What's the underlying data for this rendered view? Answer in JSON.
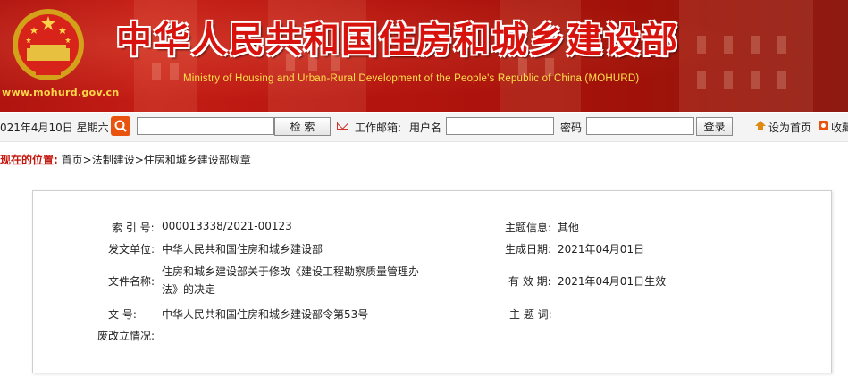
{
  "banner": {
    "title": "中华人民共和国住房和城乡建设部",
    "subtitle": "Ministry of Housing and Urban-Rural Development of the People's Republic of China (MOHURD)",
    "url": "www.mohurd.gov.cn"
  },
  "toolbar": {
    "date": "021年4月10日  星期六",
    "search_button": "检    索",
    "mail_label": "工作邮箱:",
    "username_label": "用户名",
    "password_label": "密码",
    "login_button": "登录",
    "set_home": "设为首页",
    "favorite": "收藏"
  },
  "breadcrumb": {
    "lead": "现在的位置:",
    "items": [
      "首页",
      "法制建设",
      "住房和城乡建设部规章"
    ],
    "separator": ">"
  },
  "info": {
    "index_label": "索 引 号:",
    "index_value": "000013338/2021-00123",
    "topic_label": "主题信息:",
    "topic_value": "其他",
    "issuer_label": "发文单位:",
    "issuer_value": "中华人民共和国住房和城乡建设部",
    "date_label": "生成日期:",
    "date_value": "2021年04月01日",
    "doc_name_label": "文件名称:",
    "doc_name_value": "住房和城乡建设部关于修改《建设工程勘察质量管理办法》的决定",
    "validity_label": "有 效 期:",
    "validity_value": "2021年04月01日生效",
    "doc_number_label": "文        号:",
    "doc_number_value": "中华人民共和国住房和城乡建设部令第53号",
    "keyword_label": "主 题 词:",
    "status_label": "废改立情况:"
  }
}
